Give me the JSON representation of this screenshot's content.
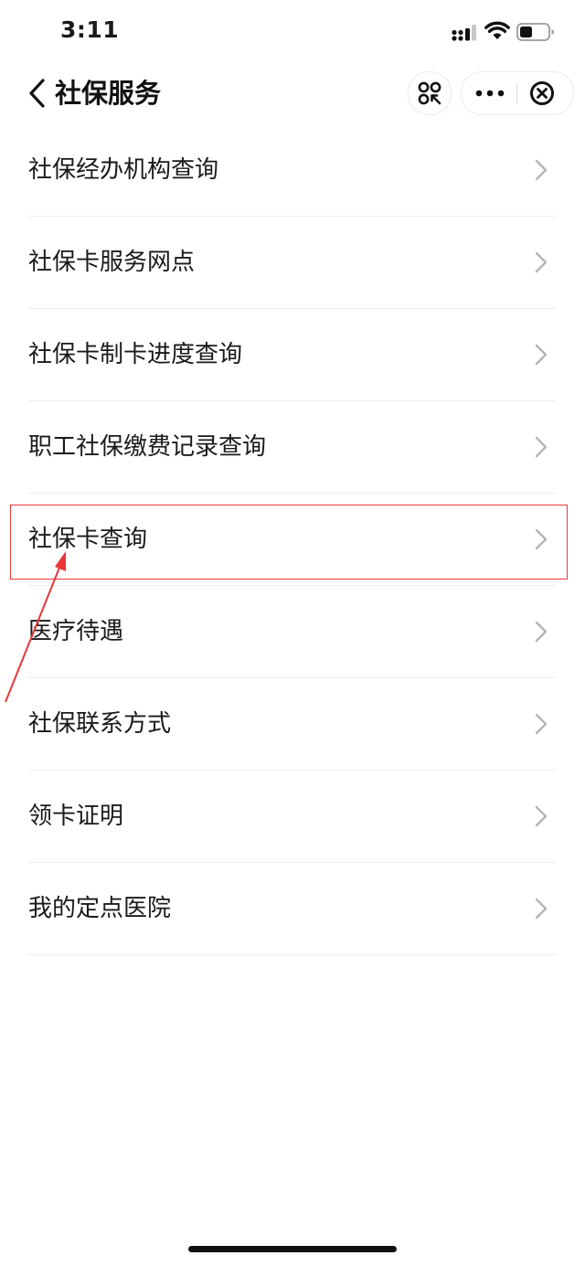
{
  "status_bar": {
    "time": "3:11"
  },
  "nav": {
    "title": "社保服务"
  },
  "menu": {
    "items": [
      {
        "label": "社保经办机构查询"
      },
      {
        "label": "社保卡服务网点"
      },
      {
        "label": "社保卡制卡进度查询"
      },
      {
        "label": "职工社保缴费记录查询"
      },
      {
        "label": "社保卡查询"
      },
      {
        "label": "医疗待遇"
      },
      {
        "label": "社保联系方式"
      },
      {
        "label": "领卡证明"
      },
      {
        "label": "我的定点医院"
      }
    ]
  },
  "colors": {
    "highlight": "#e8363a",
    "text": "#1a1a1a",
    "chevron": "#b5b5b5",
    "divider": "#eeeeee"
  },
  "icons": {
    "back": "chevron-left-icon",
    "scan": "scan-icon",
    "more": "more-dots-icon",
    "close": "close-circle-icon",
    "item_arrow": "chevron-right-icon"
  }
}
